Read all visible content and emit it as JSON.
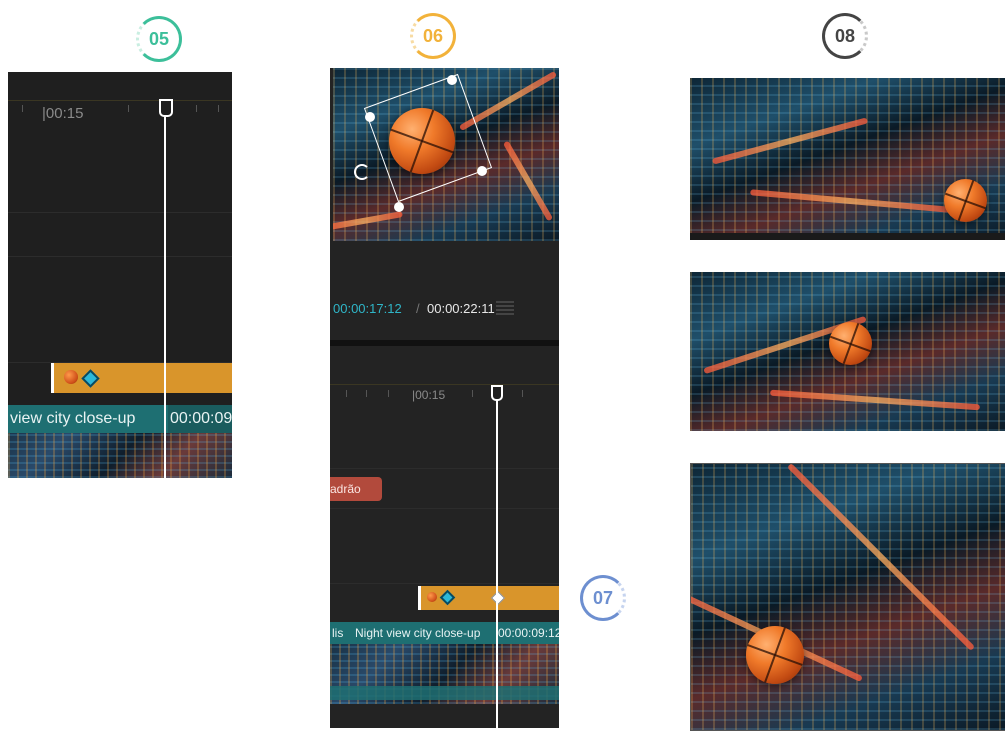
{
  "steps": {
    "s05": "05",
    "s06": "06",
    "s07": "07",
    "s08": "08"
  },
  "colors": {
    "s05": "#3cbf9a",
    "s06": "#f2b23a",
    "s07": "#6d8fd0",
    "s08": "#444444",
    "clip_orange": "#d9952b",
    "teal": "#1e6f72"
  },
  "panel5": {
    "ruler_time": "|00:15",
    "clip_label": "view city close-up",
    "clip_time": "00:00:09"
  },
  "panel6": {
    "time_current": "00:00:17:12",
    "time_separator": "/",
    "time_total": "00:00:22:11",
    "ruler_time": "|00:15",
    "effect_label": "adrão",
    "clip_label_prefix": "lis",
    "clip_label": "Night view city close-up",
    "clip_time": "00:00:09:12"
  },
  "icons": [
    "playhead-icon",
    "rotate-icon",
    "keyframe-diamond-icon",
    "basketball-sticker-icon",
    "aspect-icon"
  ]
}
